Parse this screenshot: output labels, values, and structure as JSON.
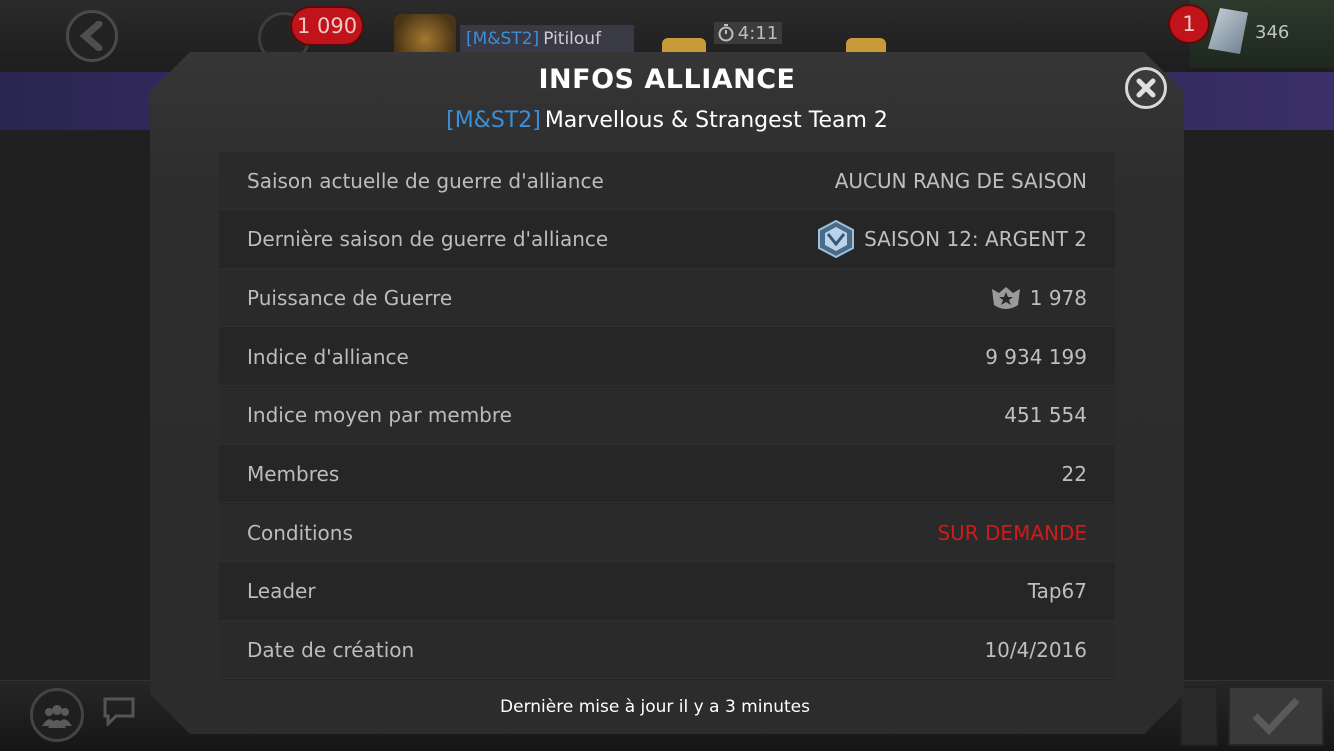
{
  "header": {
    "units_count": "1 090",
    "player": {
      "tag": "[M&ST2]",
      "name": "Pitilouf"
    },
    "timer": "4:11",
    "notification_count": "1",
    "crystal_count": "346"
  },
  "modal": {
    "title": "INFOS ALLIANCE",
    "alliance_tag": "[M&ST2]",
    "alliance_name": "Marvellous & Strangest Team 2",
    "rows": [
      {
        "label": "Saison actuelle de guerre d'alliance",
        "value": "AUCUN RANG DE SAISON"
      },
      {
        "label": "Dernière saison de guerre d'alliance",
        "value": "SAISON 12: ARGENT 2",
        "icon": "silver-rank-icon"
      },
      {
        "label": "Puissance de Guerre",
        "value": "1 978",
        "icon": "war-rating-icon"
      },
      {
        "label": "Indice d'alliance",
        "value": "9 934 199"
      },
      {
        "label": "Indice moyen par membre",
        "value": "451 554"
      },
      {
        "label": "Membres",
        "value": "22"
      },
      {
        "label": "Conditions",
        "value": "SUR DEMANDE",
        "color": "#d11a1a"
      },
      {
        "label": "Leader",
        "value": "Tap67"
      },
      {
        "label": "Date de création",
        "value": "10/4/2016"
      }
    ],
    "footer": "Dernière mise à jour il y a 3 minutes"
  }
}
